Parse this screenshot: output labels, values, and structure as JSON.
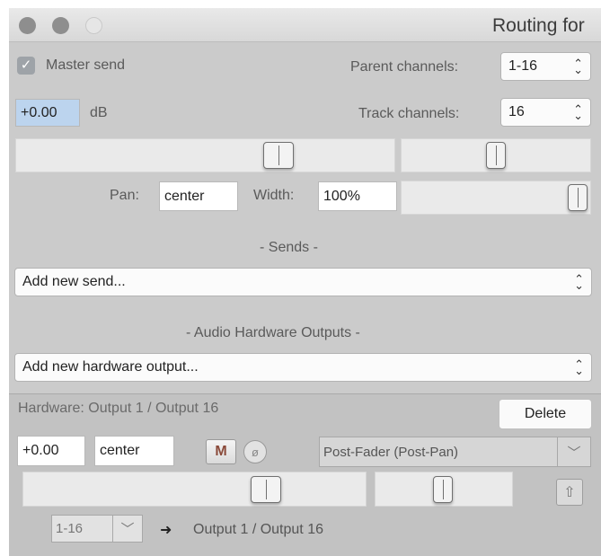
{
  "window": {
    "title": "Routing for"
  },
  "master": {
    "send_checked": true,
    "send_label": "Master send",
    "parent_channels_label": "Parent channels:",
    "parent_channels_value": "1-16",
    "gain_value": "+0.00",
    "gain_unit": "dB",
    "track_channels_label": "Track channels:",
    "track_channels_value": "16",
    "pan_label": "Pan:",
    "pan_value": "center",
    "width_label": "Width:",
    "width_value": "100%"
  },
  "sends": {
    "header": "- Sends -",
    "add_placeholder": "Add new send..."
  },
  "hardware_outputs": {
    "header": "- Audio Hardware Outputs -",
    "add_placeholder": "Add new hardware output..."
  },
  "hardware_item": {
    "title": "Hardware: Output 1 / Output 16",
    "delete_label": "Delete",
    "gain_value": "+0.00",
    "pan_value": "center",
    "mute_label": "M",
    "phase_symbol": "ø",
    "send_mode_value": "Post-Fader (Post-Pan)",
    "channels_value": "1-16",
    "arrow": "➜",
    "destination": "Output 1 / Output 16"
  },
  "icons": {
    "checkbox": "checkmark-icon",
    "chevron": "updown-chevron-icon",
    "dropdown": "chevron-down-icon",
    "up": "route-up-icon"
  }
}
